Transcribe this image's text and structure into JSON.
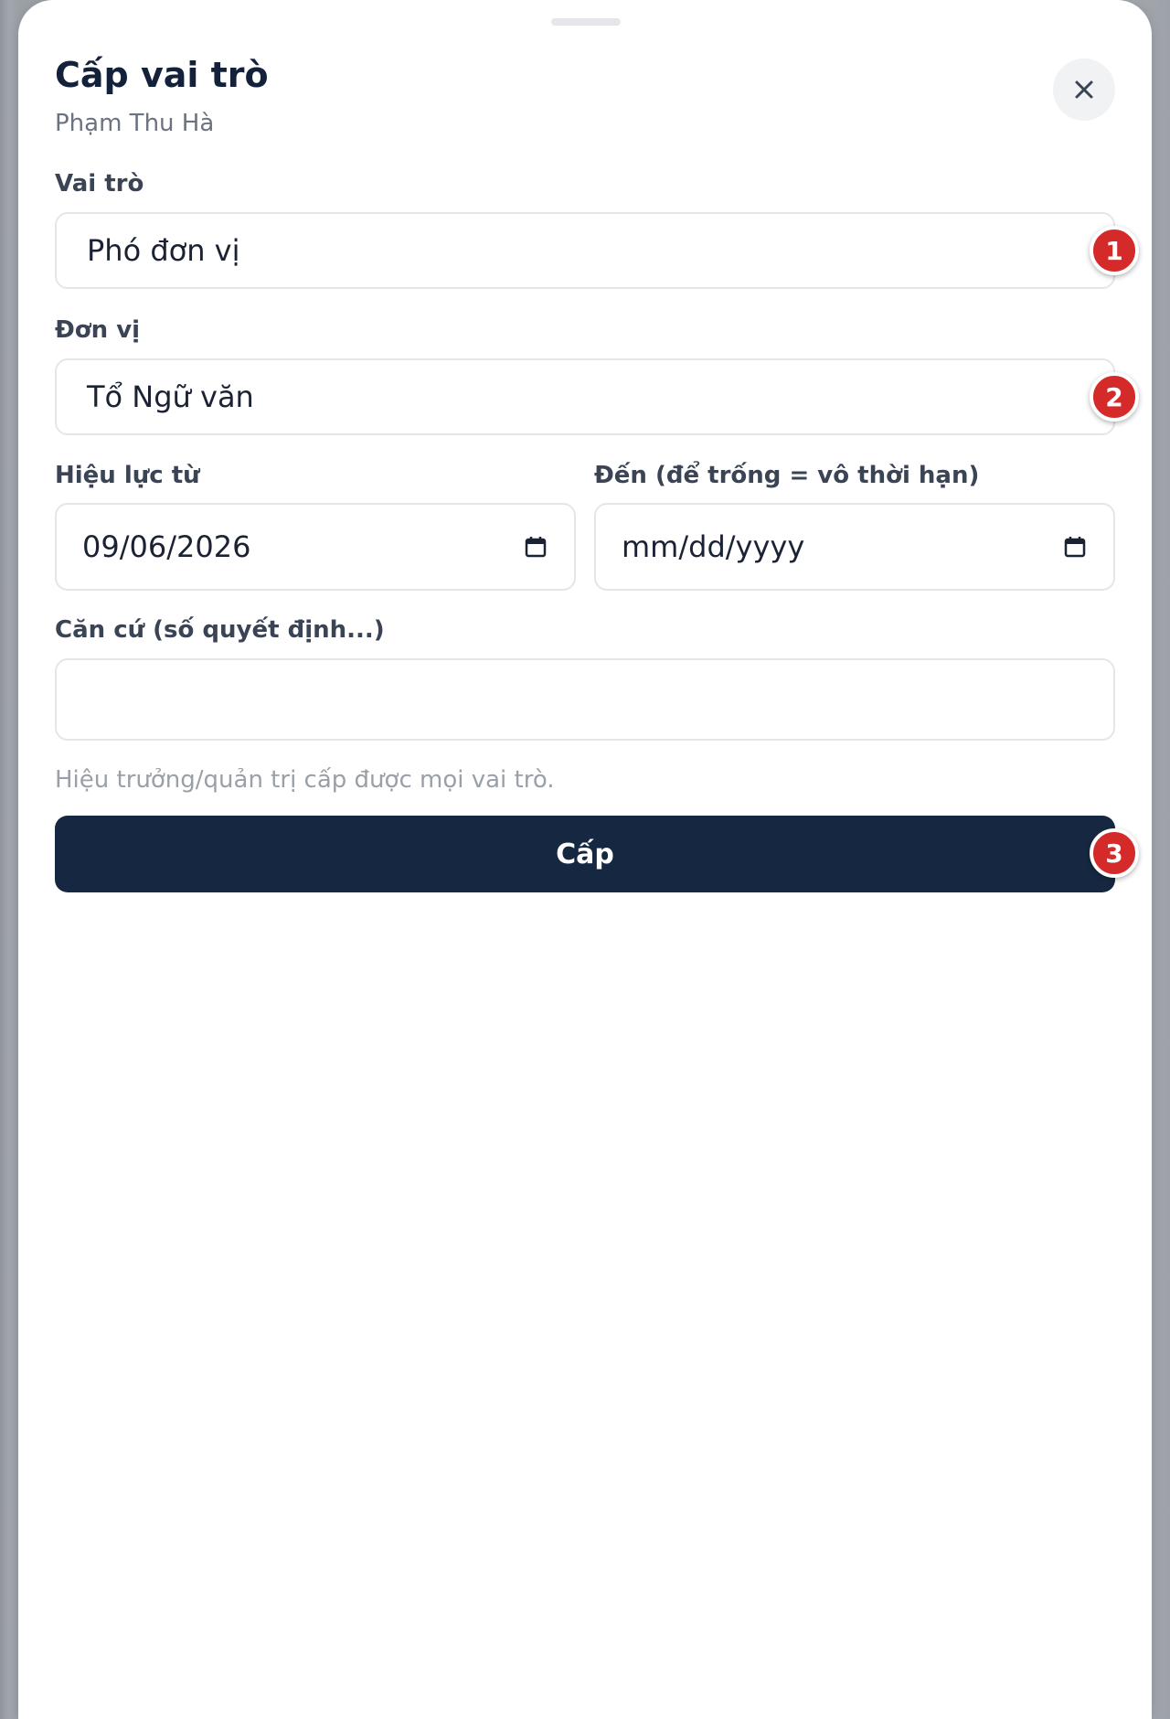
{
  "dialog": {
    "title": "Cấp vai trò",
    "subtitle": "Phạm Thu Hà",
    "close_icon": "close-icon"
  },
  "form": {
    "role": {
      "label": "Vai trò",
      "value": "Phó đơn vị"
    },
    "unit": {
      "label": "Đơn vị",
      "value": "Tổ Ngữ văn"
    },
    "valid_from": {
      "label": "Hiệu lực từ",
      "value": "09/06/2026",
      "icon": "calendar-icon"
    },
    "valid_to": {
      "label": "Đến (để trống = vô thời hạn)",
      "value": "mm/dd/yyyy",
      "icon": "calendar-icon"
    },
    "basis": {
      "label": "Căn cứ (số quyết định...)",
      "value": ""
    },
    "hint": "Hiệu trưởng/quản trị cấp được mọi vai trò.",
    "submit_label": "Cấp"
  },
  "markers": [
    "1",
    "2",
    "3"
  ],
  "colors": {
    "primary_button": "#162841",
    "marker": "#d42a2a"
  }
}
